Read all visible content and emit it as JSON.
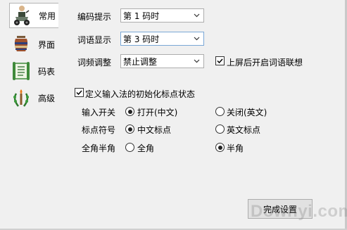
{
  "sidebar": {
    "items": [
      {
        "label": "常用",
        "icon": "scooter-icon",
        "active": true
      },
      {
        "label": "界面",
        "icon": "pottery-icon",
        "active": false
      },
      {
        "label": "码表",
        "icon": "scroll-icon",
        "active": false
      },
      {
        "label": "高级",
        "icon": "laurel-torch-icon",
        "active": false
      }
    ]
  },
  "settings": {
    "encoding_hint": {
      "label": "编码提示",
      "value": "第 1 码时"
    },
    "phrase_display": {
      "label": "词语显示",
      "value": "第 3 码时"
    },
    "freq_adjust": {
      "label": "词频调整",
      "value": "禁止调整"
    },
    "association": {
      "label": "上屏后开启词语联想",
      "checked": true
    }
  },
  "punct_group": {
    "label": "定义输入法的初始化标点状态",
    "checked": true,
    "rows": [
      {
        "label": "输入开关",
        "option_a": "打开(中文)",
        "option_b": "关闭(英文)",
        "selected": "a"
      },
      {
        "label": "标点符号",
        "option_a": "中文标点",
        "option_b": "英文标点",
        "selected": "a"
      },
      {
        "label": "全角半角",
        "option_a": "全角",
        "option_b": "半角",
        "selected": "b"
      }
    ]
  },
  "footer": {
    "finish_label": "完成设置"
  },
  "watermark": "Downyi.com"
}
